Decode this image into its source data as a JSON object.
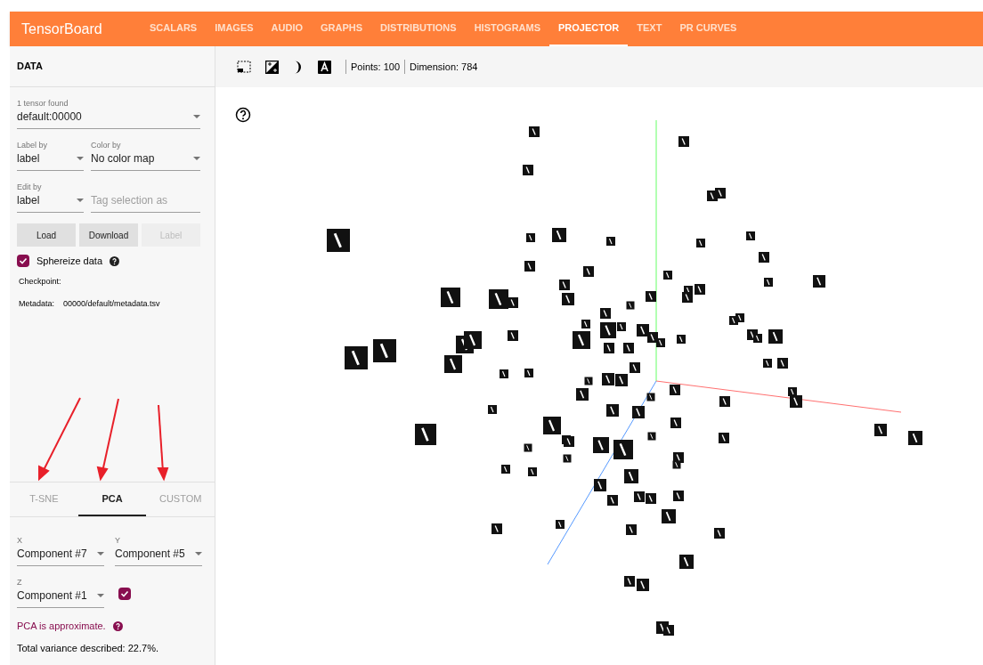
{
  "app_title": "TensorBoard",
  "nav_tabs": [
    {
      "label": "SCALARS",
      "selected": false
    },
    {
      "label": "IMAGES",
      "selected": false
    },
    {
      "label": "AUDIO",
      "selected": false
    },
    {
      "label": "GRAPHS",
      "selected": false
    },
    {
      "label": "DISTRIBUTIONS",
      "selected": false
    },
    {
      "label": "HISTOGRAMS",
      "selected": false
    },
    {
      "label": "PROJECTOR",
      "selected": true
    },
    {
      "label": "TEXT",
      "selected": false
    },
    {
      "label": "PR CURVES",
      "selected": false
    }
  ],
  "data_panel": {
    "title": "DATA",
    "tensor_select": {
      "label": "1 tensor found",
      "value": "default:00000"
    },
    "label_by": {
      "label": "Label by",
      "value": "label"
    },
    "color_by": {
      "label": "Color by",
      "value": "No color map"
    },
    "edit_by": {
      "label": "Edit by",
      "value": "label"
    },
    "tag_field": {
      "placeholder": "Tag selection as"
    },
    "buttons": [
      {
        "label": "Load",
        "disabled": false
      },
      {
        "label": "Download",
        "disabled": false
      },
      {
        "label": "Label",
        "disabled": true
      }
    ],
    "sphereize": {
      "label": "Sphereize data",
      "checked": true
    },
    "checkpoint": {
      "label": "Checkpoint:"
    },
    "metadata": {
      "label": "Metadata:",
      "value": "00000/default/metadata.tsv"
    }
  },
  "projection_tabs": [
    {
      "label": "T-SNE",
      "selected": false
    },
    {
      "label": "PCA",
      "selected": true
    },
    {
      "label": "CUSTOM",
      "selected": false
    }
  ],
  "pca": {
    "x": {
      "label": "X",
      "value": "Component #7"
    },
    "y": {
      "label": "Y",
      "value": "Component #5"
    },
    "z": {
      "label": "Z",
      "value": "Component #1"
    },
    "z_enabled": true,
    "note": "PCA is approximate.",
    "variance": "Total variance described: 22.7%."
  },
  "toolbar": {
    "points": "Points: 100",
    "dimension": "Dimension: 784"
  }
}
